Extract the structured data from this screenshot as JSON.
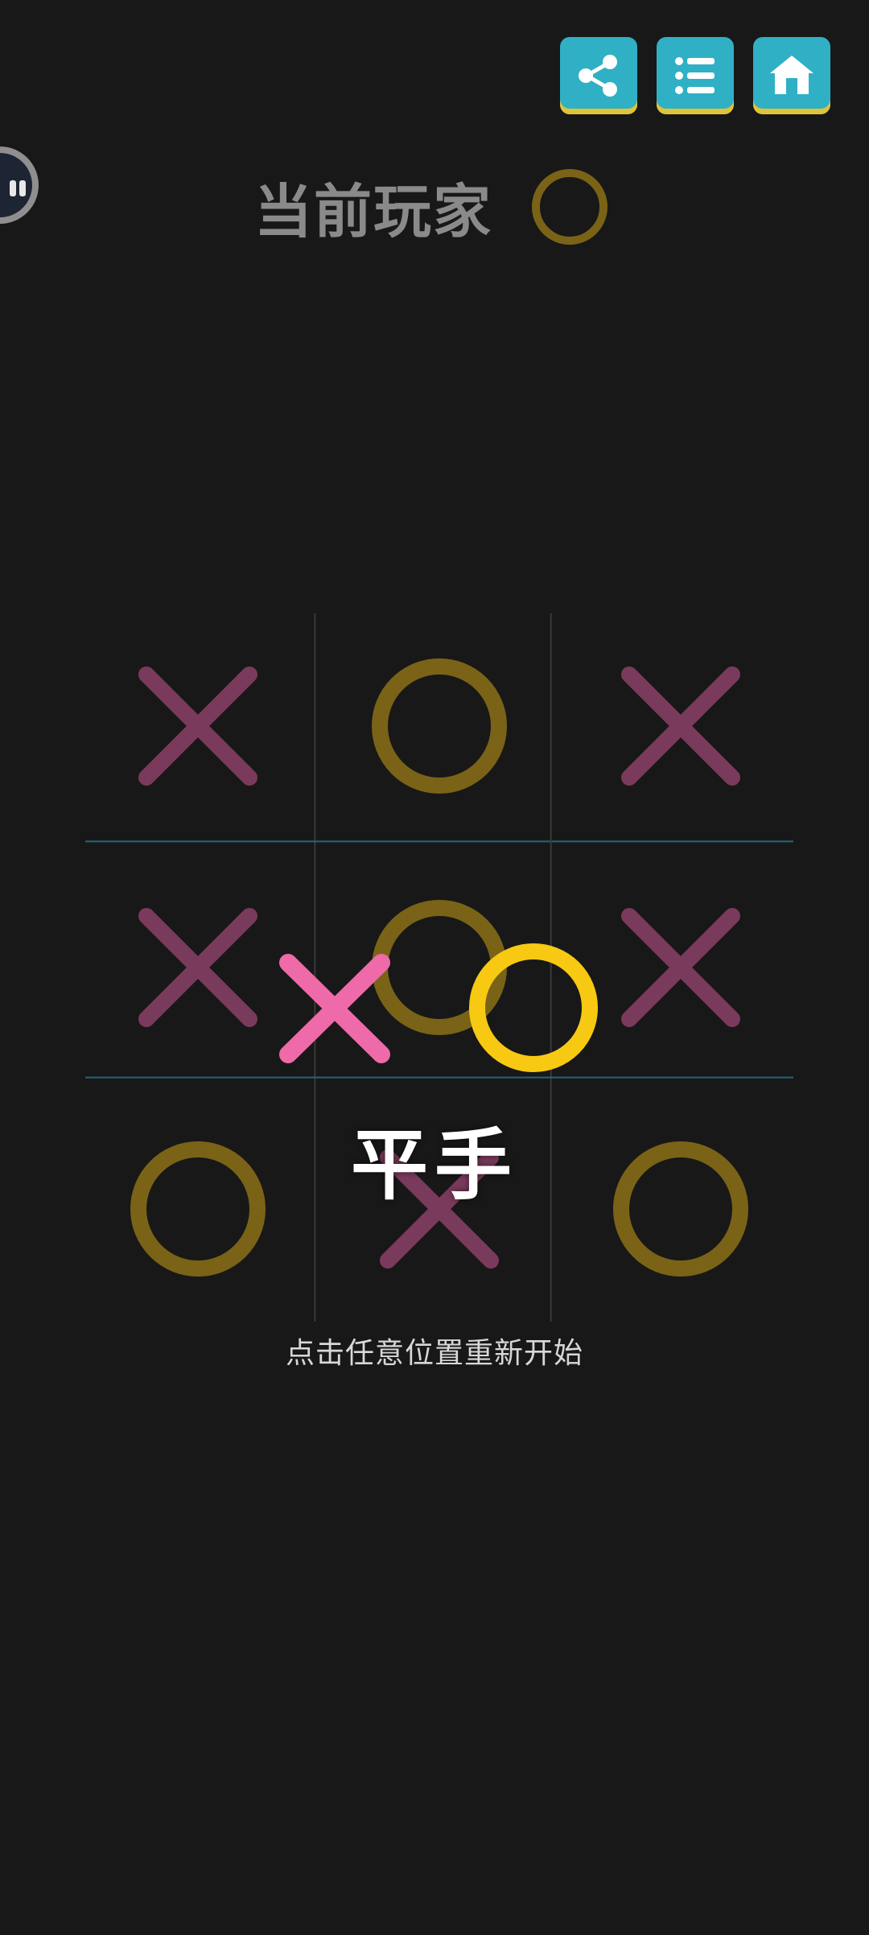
{
  "colors": {
    "background": "#181818",
    "button_bg": "#2fb0c5",
    "button_accent": "#e0c33a",
    "x_dim": "#7a3a5c",
    "o_dim": "#7a6316",
    "x_bright": "#ef6aa8",
    "o_bright": "#f7c912",
    "grid_vertical": "#3a3a3a",
    "grid_horizontal": "#1f6a78"
  },
  "toolbar": {
    "buttons": [
      {
        "name": "share",
        "icon": "share-icon"
      },
      {
        "name": "list",
        "icon": "list-icon"
      },
      {
        "name": "home",
        "icon": "home-icon"
      }
    ]
  },
  "status": {
    "current_label": "当前玩家",
    "current_mark": "O"
  },
  "board": {
    "cells": [
      [
        "X",
        "O",
        "X"
      ],
      [
        "X",
        "O",
        "X"
      ],
      [
        "O",
        "X",
        "O"
      ]
    ]
  },
  "result": {
    "text": "平手",
    "restart_hint": "点击任意位置重新开始",
    "marks": [
      "X",
      "O"
    ]
  }
}
